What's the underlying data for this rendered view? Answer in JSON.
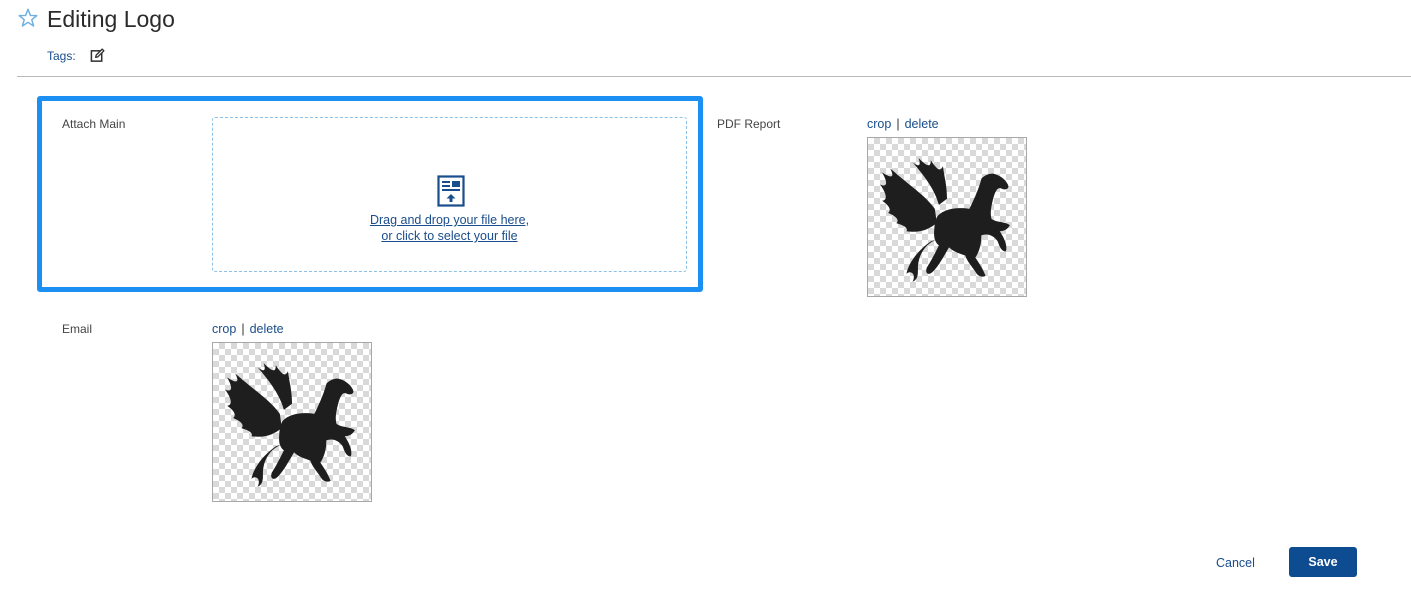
{
  "header": {
    "title": "Editing Logo",
    "tags_label": "Tags:",
    "star_icon": "star-outline-icon",
    "tags_edit_icon": "edit-icon"
  },
  "fields": {
    "attach_main": {
      "label": "Attach Main",
      "drop_line1": "Drag and drop your file here,",
      "drop_line2": "or click to select your file",
      "icon": "file-upload-icon"
    },
    "pdf_report": {
      "label": "PDF Report",
      "crop": "crop",
      "separator": "|",
      "delete": "delete",
      "image": "pegasus-logo"
    },
    "email": {
      "label": "Email",
      "crop": "crop",
      "separator": "|",
      "delete": "delete",
      "image": "pegasus-logo"
    }
  },
  "footer": {
    "cancel": "Cancel",
    "save": "Save"
  },
  "colors": {
    "accent": "#1b8ff2",
    "link": "#1a4d8c",
    "save_bg": "#0e4c92"
  }
}
